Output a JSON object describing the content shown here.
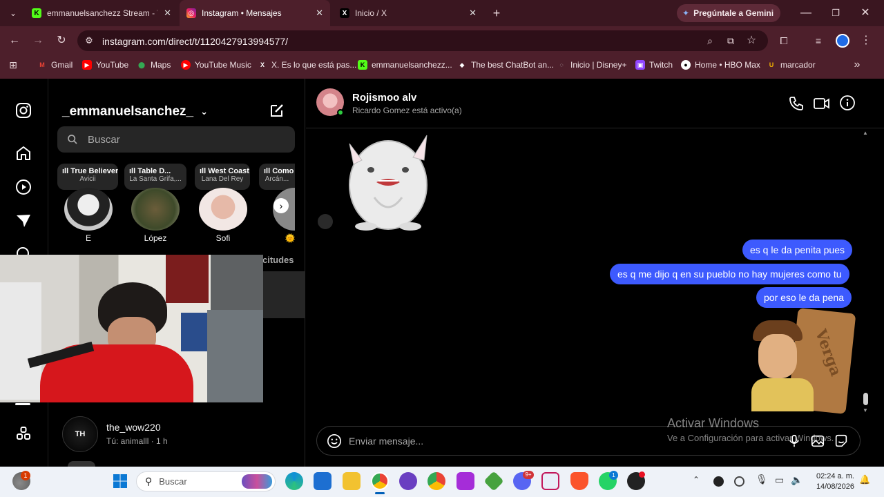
{
  "browser": {
    "tabs": [
      {
        "label": "emmanuelsanchezz Stream - W",
        "active": false
      },
      {
        "label": "Instagram • Mensajes",
        "active": true
      },
      {
        "label": "Inicio / X",
        "active": false
      }
    ],
    "gemini_label": "Pregúntale a Gemini",
    "url": "instagram.com/direct/t/1120427913994577/",
    "bookmarks": [
      "Gmail",
      "YouTube",
      "Maps",
      "YouTube Music",
      "X. Es lo que está pas...",
      "emmanuelsanchezz...",
      "The best ChatBot an...",
      "Inicio | Disney+",
      "Twitch",
      "Home • HBO Max",
      "marcador"
    ]
  },
  "inbox": {
    "username": "_emmanuelsanchez_",
    "search_placeholder": "Buscar",
    "notes": [
      {
        "title": "True Believer",
        "artist": "Avicii"
      },
      {
        "title": "Table D...",
        "artist": "La Santa Grifa,..."
      },
      {
        "title": "West Coast",
        "artist": "Lana Del Rey"
      },
      {
        "title": "Como T...",
        "artist": "Arcán..."
      }
    ],
    "stories": [
      {
        "name": "E"
      },
      {
        "name": "López"
      },
      {
        "name": "Sofi"
      },
      {
        "name": "🌞"
      }
    ],
    "requests_partial": "citudes",
    "conversations": [
      {
        "name": "the_wow220",
        "preview": "Tú: animalll · 1 h",
        "avatar_text": "TH"
      }
    ]
  },
  "chat": {
    "contact_name": "Rojismoo alv",
    "contact_status": "Ricardo Gomez está activo(a)",
    "messages": [
      {
        "text": "es q le da penita pues",
        "from": "me"
      },
      {
        "text": "es q me dijo q en su pueblo no hay mujeres como tu",
        "from": "me"
      },
      {
        "text": "por eso le da pena",
        "from": "me"
      }
    ],
    "sticker_caption": "Verga",
    "composer_placeholder": "Enviar mensaje..."
  },
  "watermark": {
    "title": "Activar Windows",
    "subtitle": "Ve a Configuración para activar Windows."
  },
  "taskbar": {
    "search_placeholder": "Buscar",
    "time": "02:24 a. m.",
    "date": "14/08/2026",
    "weather_badge": "1",
    "discord_badge": "9+",
    "whatsapp_badge": "1"
  },
  "colors": {
    "browser_frame": "#4d1f2b",
    "bubble": "#3d5afe",
    "ig_bg": "#000000"
  }
}
